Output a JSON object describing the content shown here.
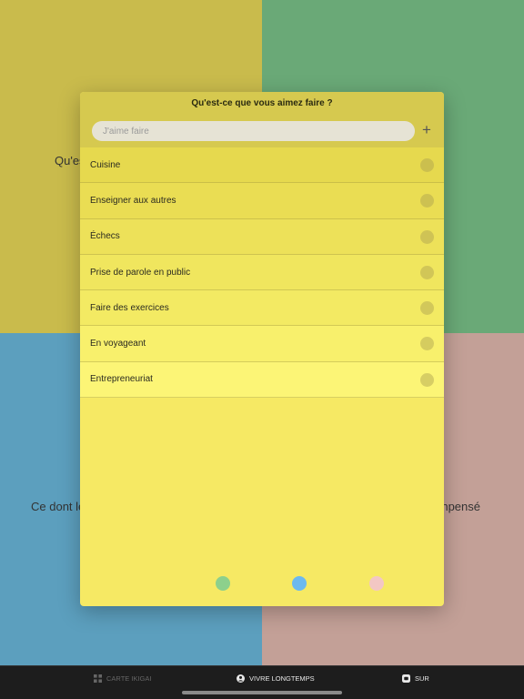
{
  "quadrants": {
    "top_left": {
      "label": "Qu'es",
      "color": "#c9bb4c"
    },
    "top_right": {
      "label": "",
      "color": "#6aa977"
    },
    "bottom_left": {
      "label": "Ce dont le",
      "color": "#5c9fbe"
    },
    "bottom_right": {
      "label": "npensé",
      "color": "#c3a097"
    }
  },
  "modal": {
    "title": "Qu'est-ce que vous aimez faire ?",
    "search": {
      "placeholder": "J'aime faire",
      "value": ""
    },
    "add_label": "+",
    "items": [
      {
        "label": "Cuisine",
        "color": "#e6d94e"
      },
      {
        "label": "Enseigner aux autres",
        "color": "#eadd53"
      },
      {
        "label": "Échecs",
        "color": "#ede159"
      },
      {
        "label": "Prise de parole en public",
        "color": "#f0e65e"
      },
      {
        "label": "Faire des exercices",
        "color": "#f3ea63"
      },
      {
        "label": "En voyageant",
        "color": "#f8f06c"
      },
      {
        "label": "Entrepreneuriat",
        "color": "#fcf576"
      }
    ],
    "background": "#f6e964",
    "color_dots": [
      {
        "name": "green",
        "color": "#8dd08c"
      },
      {
        "name": "blue",
        "color": "#6cb9ef"
      },
      {
        "name": "pink",
        "color": "#f3c7c4"
      }
    ]
  },
  "tabbar": {
    "tabs": [
      {
        "label": "CARTE IKIGAI",
        "icon": "grid-icon",
        "active": false
      },
      {
        "label": "VIVRE LONGTEMPS",
        "icon": "person-icon",
        "active": true
      },
      {
        "label": "SUR",
        "icon": "info-icon",
        "active": false
      }
    ]
  }
}
